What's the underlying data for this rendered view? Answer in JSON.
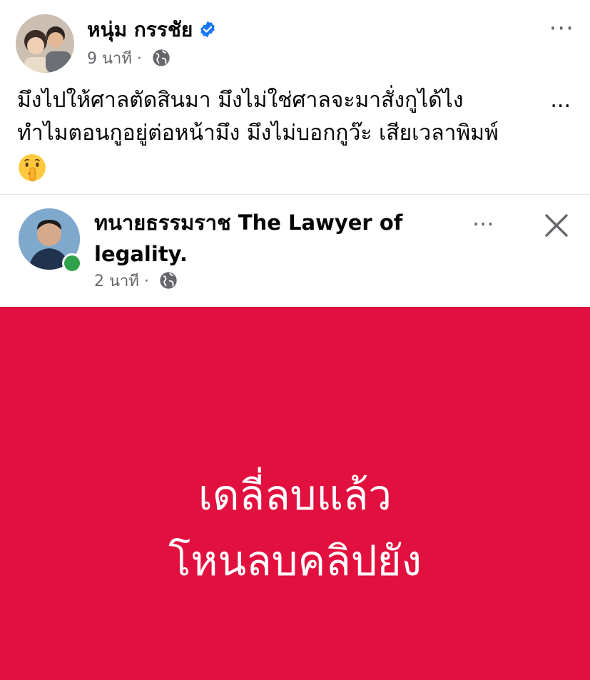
{
  "post": {
    "author": "หนุ่ม กรรชัย",
    "time": "9 นาที",
    "separator": "·",
    "more_label": "···",
    "text_lines": [
      "มึงไปให้ศาลตัดสินมา มึงไม่ใช่ศาลจะมาสั่งกูได้ไง",
      "ทำไมตอนกูอยู่ต่อหน้ามึง มึงไม่บอกกูว๊ะ เสียเวลาพิมพ์"
    ],
    "see_more": "...",
    "emoji": "shushing-face",
    "colors": {
      "verified": "#1877f2",
      "meta": "#65676b"
    }
  },
  "shared_post": {
    "author": "ทนายธรรมราช The Lawyer of legality.",
    "time": "2 นาที",
    "separator": "·",
    "more_label": "···",
    "online": true,
    "banner": {
      "background": "#e2103f",
      "lines": [
        "เดลี่ลบแล้ว",
        "โหนลบคลิปยัง"
      ]
    }
  }
}
